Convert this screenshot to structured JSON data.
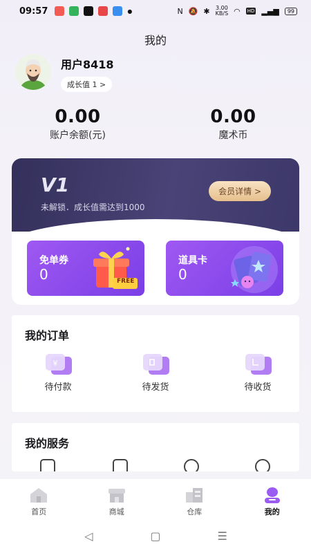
{
  "status_bar": {
    "time": "09:57",
    "net_speed_value": "3.00",
    "net_speed_unit": "KB/S",
    "battery": "99"
  },
  "page": {
    "title": "我的"
  },
  "profile": {
    "username": "用户8418",
    "growth_chip": "成长值 1 >"
  },
  "balances": [
    {
      "value": "0.00",
      "label": "账户余额(元)"
    },
    {
      "value": "0.00",
      "label": "魔术币"
    }
  ],
  "vip": {
    "level": "V1",
    "description": "未解锁．成长值需达到1000",
    "detail_button": "会员详情 >"
  },
  "coupons": [
    {
      "title": "免单券",
      "count": "0",
      "art_text": "FREE"
    },
    {
      "title": "道具卡",
      "count": "0"
    }
  ],
  "orders": {
    "title": "我的订单",
    "items": [
      {
        "label": "待付款",
        "icon": "payment-icon"
      },
      {
        "label": "待发货",
        "icon": "shipping-icon"
      },
      {
        "label": "待收货",
        "icon": "receive-icon"
      }
    ]
  },
  "services": {
    "title": "我的服务"
  },
  "tabbar": [
    {
      "label": "首页",
      "icon": "home-icon",
      "active": false
    },
    {
      "label": "商城",
      "icon": "store-icon",
      "active": false
    },
    {
      "label": "仓库",
      "icon": "warehouse-icon",
      "active": false
    },
    {
      "label": "我的",
      "icon": "profile-icon",
      "active": true
    }
  ],
  "colors": {
    "accent_purple": "#8b4cf0",
    "vip_dark": "#3c3869",
    "vip_gold": "#e6bf8c"
  }
}
